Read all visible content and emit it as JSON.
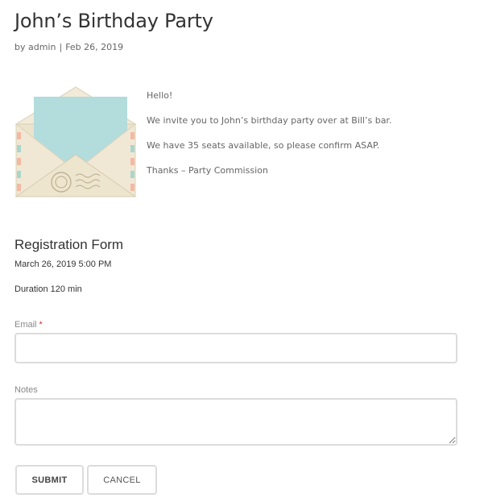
{
  "post": {
    "title": "John’s Birthday Party",
    "meta": {
      "by": "by admin",
      "separator": "|",
      "date": "Feb 26, 2019"
    },
    "content": [
      "Hello!",
      "We invite you to John’s birthday party over at Bill’s bar.",
      "We have 35 seats available, so please confirm ASAP.",
      "Thanks – Party Commission"
    ],
    "image_icon": "envelope-with-letter-illustration"
  },
  "form": {
    "title": "Registration Form",
    "date": "March 26, 2019 5:00 PM",
    "duration": "Duration 120 min",
    "email": {
      "label": "Email",
      "required_mark": "*",
      "value": ""
    },
    "notes": {
      "label": "Notes",
      "value": ""
    },
    "submit_label": "SUBMIT",
    "cancel_label": "CANCEL"
  },
  "colors": {
    "heading": "#333333",
    "body_text": "#666666",
    "label": "#888888",
    "required": "#d63638",
    "border": "#dcdcdc",
    "letter": "#a9d8d8",
    "envelope": "#eee6d2"
  }
}
